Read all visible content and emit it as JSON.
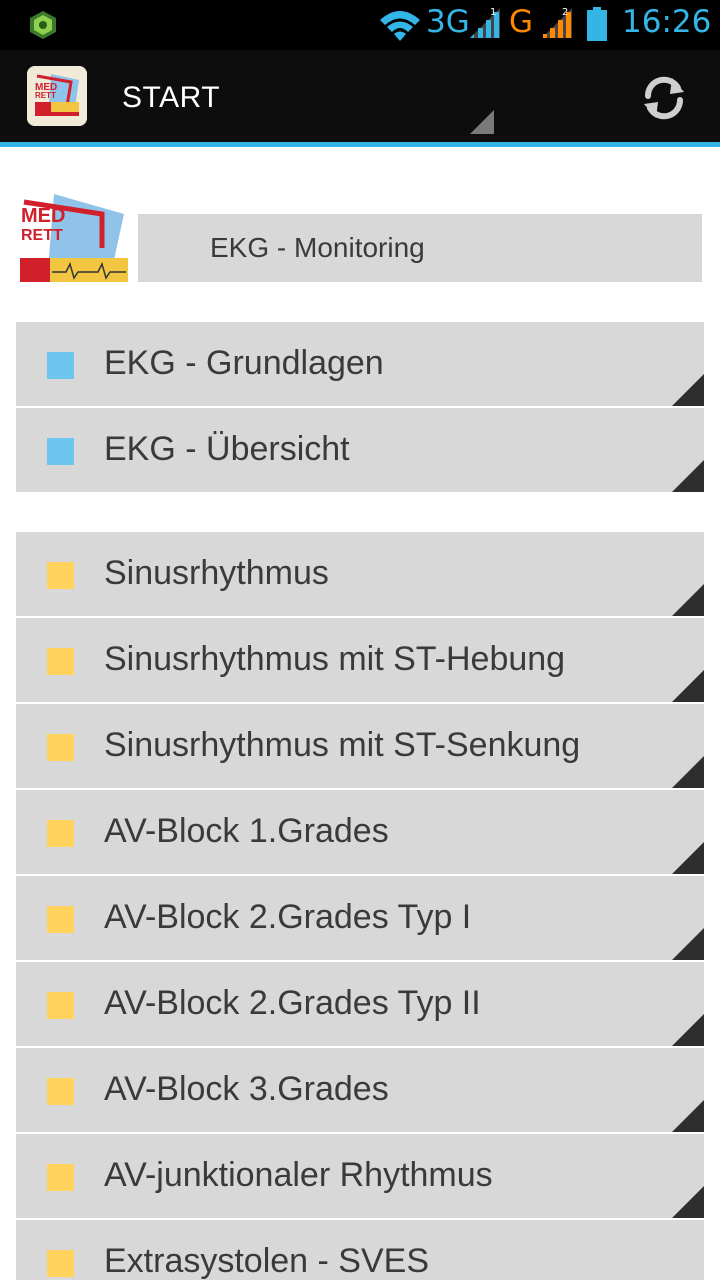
{
  "status_bar": {
    "network1": "3G",
    "signal1_sim": "1",
    "network2": "G",
    "signal2_sim": "2",
    "time": "16:26",
    "icons": [
      "app-notification-icon",
      "wifi-icon",
      "signal-icon",
      "signal-icon",
      "battery-icon"
    ]
  },
  "action_bar": {
    "title": "START",
    "refresh_icon": "refresh-icon"
  },
  "header": {
    "logo_text": "MED RETT",
    "title": "EKG - Monitoring"
  },
  "sections": [
    {
      "color": "#6ec6ee",
      "items": [
        {
          "label": "EKG - Grundlagen"
        },
        {
          "label": "EKG - Übersicht"
        }
      ]
    },
    {
      "color": "#ffd35e",
      "items": [
        {
          "label": "Sinusrhythmus"
        },
        {
          "label": "Sinusrhythmus mit ST-Hebung"
        },
        {
          "label": "Sinusrhythmus mit ST-Senkung"
        },
        {
          "label": "AV-Block 1.Grades"
        },
        {
          "label": "AV-Block 2.Grades Typ I"
        },
        {
          "label": "AV-Block 2.Grades Typ II"
        },
        {
          "label": "AV-Block 3.Grades"
        },
        {
          "label": "AV-junktionaler Rhythmus"
        },
        {
          "label": "Extrasystolen - SVES"
        }
      ]
    }
  ]
}
